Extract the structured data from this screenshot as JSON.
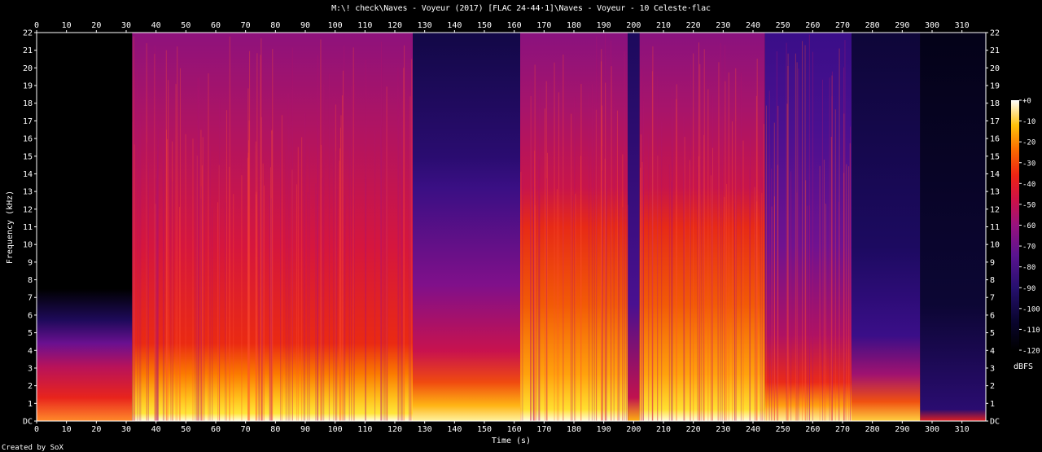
{
  "window_title": "M:\\! check\\Naves - Voyeur (2017) [FLAC 24-44·1]\\Naves - Voyeur - 10 Celeste·flac",
  "credit": "Created by SoX",
  "chart_data": {
    "type": "heatmap",
    "title": "M:\\! check\\Naves - Voyeur (2017) [FLAC 24-44·1]\\Naves - Voyeur - 10 Celeste·flac",
    "xlabel": "Time (s)",
    "ylabel": "Frequency (kHz)",
    "xlim": [
      0,
      318
    ],
    "ylim": [
      0,
      22
    ],
    "x_ticks": [
      "0",
      "10",
      "20",
      "30",
      "40",
      "50",
      "60",
      "70",
      "80",
      "90",
      "100",
      "110",
      "120",
      "130",
      "140",
      "150",
      "160",
      "170",
      "180",
      "190",
      "200",
      "210",
      "220",
      "230",
      "240",
      "250",
      "260",
      "270",
      "280",
      "290",
      "300",
      "310"
    ],
    "y_ticks": [
      "DC",
      "1",
      "2",
      "3",
      "4",
      "5",
      "6",
      "7",
      "8",
      "9",
      "10",
      "11",
      "12",
      "13",
      "14",
      "15",
      "16",
      "17",
      "18",
      "19",
      "20",
      "21",
      "22"
    ],
    "colorbar": {
      "label": "dBFS",
      "ticks": [
        "+0",
        "-10",
        "-20",
        "-30",
        "-40",
        "-50",
        "-60",
        "-70",
        "-80",
        "-90",
        "-100",
        "-110",
        "-120"
      ],
      "range": [
        -120,
        0
      ]
    },
    "segments": [
      {
        "t_start": 0,
        "t_end": 32,
        "level": "quiet intro, content below 5 kHz"
      },
      {
        "t_start": 32,
        "t_end": 126,
        "level": "loud full-band to 22 kHz"
      },
      {
        "t_start": 126,
        "t_end": 162,
        "level": "softer, band-limited near 13-15 kHz"
      },
      {
        "t_start": 162,
        "t_end": 198,
        "level": "loud full-band to 22 kHz"
      },
      {
        "t_start": 198,
        "t_end": 202,
        "level": "brief dip"
      },
      {
        "t_start": 202,
        "t_end": 244,
        "level": "loud full-band to 22 kHz"
      },
      {
        "t_start": 244,
        "t_end": 273,
        "level": "moderate, full-band"
      },
      {
        "t_start": 273,
        "t_end": 296,
        "level": "fading, content below 3 kHz"
      },
      {
        "t_start": 296,
        "t_end": 318,
        "level": "near silence"
      }
    ],
    "colors": {
      "background": "#000000",
      "axis": "#ffffff"
    }
  }
}
